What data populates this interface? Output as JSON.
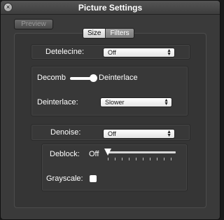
{
  "window": {
    "title": "Picture Settings"
  },
  "toolbar": {
    "preview_label": "Preview"
  },
  "tabs": [
    {
      "label": "Size"
    },
    {
      "label": "Filters"
    }
  ],
  "filters": {
    "detelecine": {
      "label": "Detelecine:",
      "value": "Off"
    },
    "decomb_switch": {
      "left_label": "Decomb",
      "right_label": "Deinterlace",
      "selected": "Deinterlace"
    },
    "deinterlace": {
      "label": "Deinterlace:",
      "value": "Slower"
    },
    "denoise": {
      "label": "Denoise:",
      "value": "Off"
    },
    "deblock": {
      "label": "Deblock:",
      "value_label": "Off"
    },
    "grayscale": {
      "label": "Grayscale:",
      "checked": false
    }
  },
  "icons": {
    "close": "close-icon",
    "popup_arrows": "up-down-arrows-icon"
  }
}
